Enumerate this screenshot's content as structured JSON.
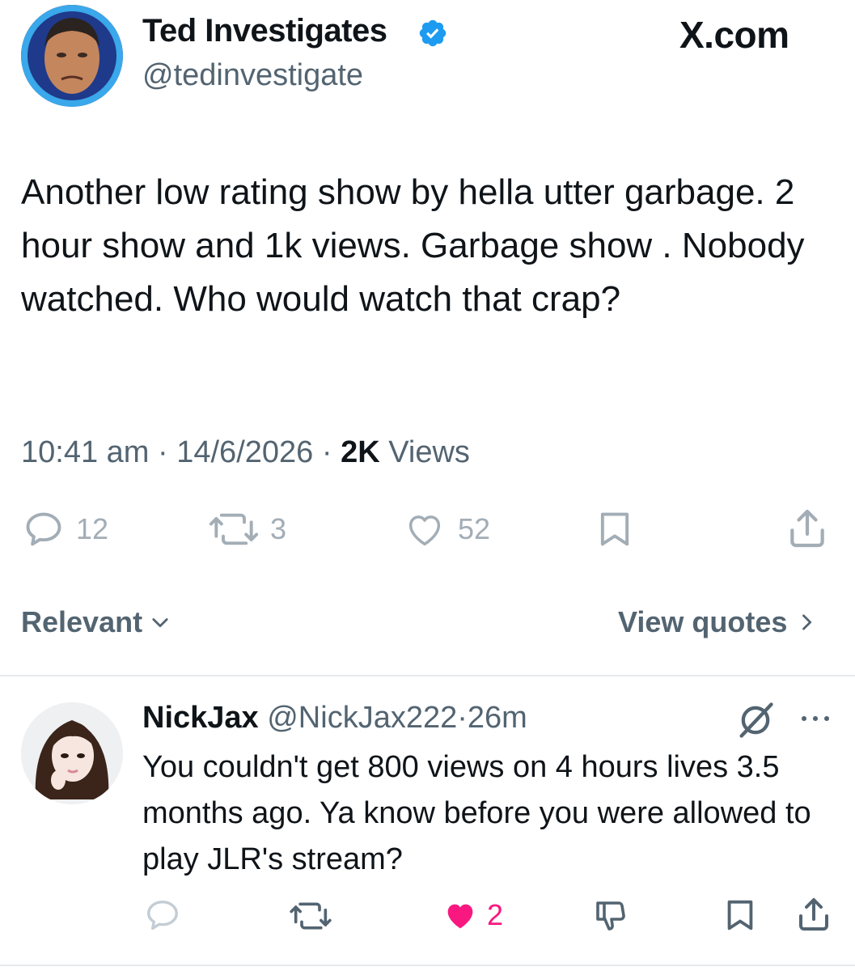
{
  "author": {
    "name": "Ted Investigates",
    "handle": "@tedinvestigate",
    "verified_icon": "verified-badge-icon"
  },
  "site_mark": "X.com",
  "tweet": {
    "text": "Another low rating show by hella utter garbage. 2 hour show and 1k views. Garbage show . Nobody watched. Who would watch that crap?",
    "time": "10:41 am",
    "date": "14/6/2026",
    "views_count": "2K",
    "views_label": "Views",
    "separator": "·"
  },
  "actions": {
    "replies": "12",
    "reposts": "3",
    "likes": "52"
  },
  "sort": {
    "label": "Relevant"
  },
  "view_quotes": {
    "label": "View quotes"
  },
  "reply": {
    "name": "NickJax",
    "handle": "@NickJax222",
    "separator": "·",
    "age": "26m",
    "text": "You couldn't get 800 views on 4 hours lives 3.5 months ago. Ya know before you were allowed to play JLR's stream?",
    "likes": "2"
  },
  "colors": {
    "accent": "#1d9bf0",
    "muted": "#536471",
    "action_grey": "#a3adb6",
    "like_pink": "#f91880",
    "text": "#0f1419"
  }
}
